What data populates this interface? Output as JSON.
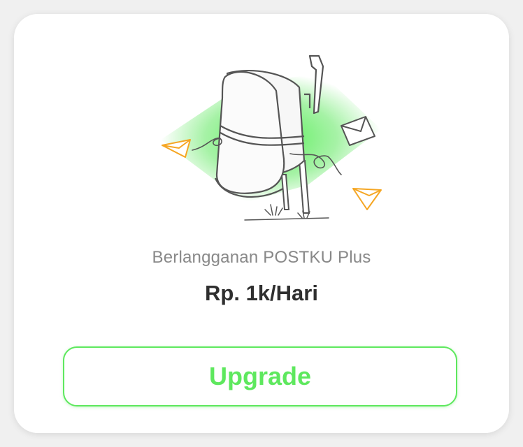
{
  "plan": {
    "subtitle": "Berlangganan POSTKU Plus",
    "price": "Rp. 1k/Hari"
  },
  "actions": {
    "upgrade_label": "Upgrade"
  },
  "illustration": {
    "icon": "mailbox-illustration",
    "accent_color": "#5ee85e",
    "envelope_color": "#f5a623"
  },
  "colors": {
    "primary": "#5ee85e",
    "price_text": "#2f2f2f",
    "subtitle_text": "#888888",
    "card_background": "#ffffff"
  }
}
